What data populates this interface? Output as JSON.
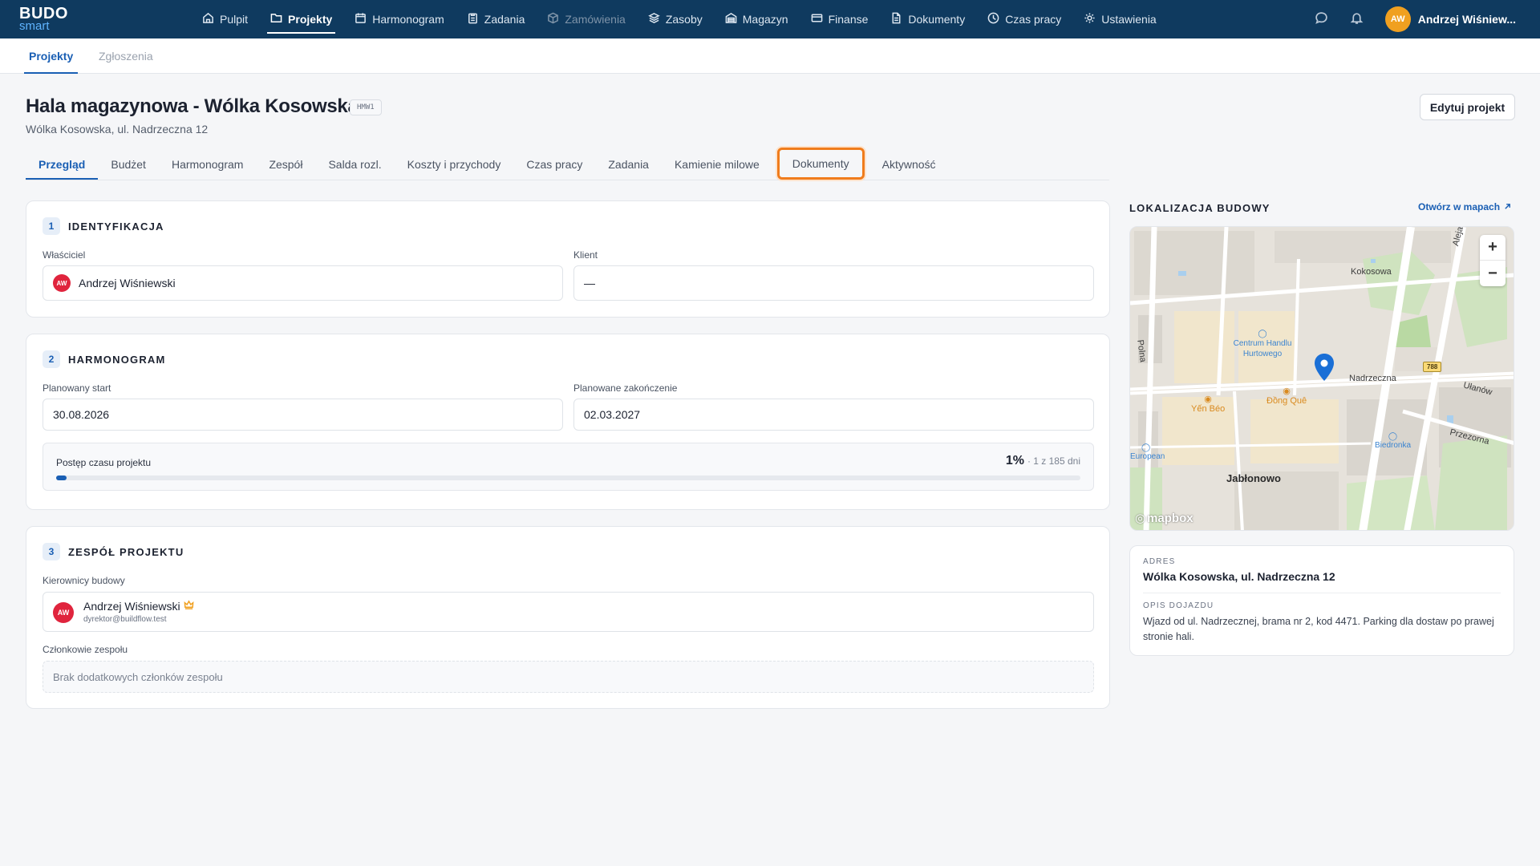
{
  "app": {
    "logo_top": "BUDO",
    "logo_bottom": "smart"
  },
  "topnav": {
    "items": [
      {
        "label": "Pulpit",
        "icon": "home-icon"
      },
      {
        "label": "Projekty",
        "icon": "folder-icon",
        "active": true
      },
      {
        "label": "Harmonogram",
        "icon": "calendar-icon"
      },
      {
        "label": "Zadania",
        "icon": "clipboard-icon"
      },
      {
        "label": "Zamówienia",
        "icon": "box-icon",
        "disabled": true
      },
      {
        "label": "Zasoby",
        "icon": "layers-icon"
      },
      {
        "label": "Magazyn",
        "icon": "warehouse-icon"
      },
      {
        "label": "Finanse",
        "icon": "card-icon"
      },
      {
        "label": "Dokumenty",
        "icon": "document-icon"
      },
      {
        "label": "Czas pracy",
        "icon": "clock-icon"
      },
      {
        "label": "Ustawienia",
        "icon": "gear-icon"
      }
    ],
    "user_initials": "AW",
    "user_name": "Andrzej Wiśniew..."
  },
  "subnav": {
    "items": [
      "Projekty",
      "Zgłoszenia"
    ]
  },
  "project": {
    "title": "Hala magazynowa - Wólka Kosowska",
    "code": "HMW1",
    "address": "Wólka Kosowska, ul. Nadrzeczna 12",
    "edit_label": "Edytuj projekt"
  },
  "tabs": [
    "Przegląd",
    "Budżet",
    "Harmonogram",
    "Zespół",
    "Salda rozl.",
    "Koszty i przychody",
    "Czas pracy",
    "Zadania",
    "Kamienie milowe",
    "Dokumenty",
    "Aktywność"
  ],
  "identification": {
    "num": "1",
    "title": "IDENTYFIKACJA",
    "owner_label": "Właściciel",
    "owner_initials": "AW",
    "owner_name": "Andrzej Wiśniewski",
    "client_label": "Klient",
    "client_value": "—"
  },
  "schedule": {
    "num": "2",
    "title": "HARMONOGRAM",
    "start_label": "Planowany start",
    "start_value": "30.08.2026",
    "end_label": "Planowane zakończenie",
    "end_value": "02.03.2027",
    "progress_label": "Postęp czasu projektu",
    "progress_pct": "1%",
    "progress_detail": "· 1 z 185 dni",
    "progress_fraction": 0.01
  },
  "team": {
    "num": "3",
    "title": "ZESPÓŁ PROJEKTU",
    "managers_label": "Kierownicy budowy",
    "manager_initials": "AW",
    "manager_name": "Andrzej Wiśniewski",
    "manager_email": "dyrektor@buildflow.test",
    "members_label": "Członkowie zespołu",
    "members_empty": "Brak dodatkowych członków zespołu"
  },
  "location": {
    "title": "LOKALIZACJA BUDOWY",
    "open_maps": "Otwórz w mapach",
    "zoom_in": "+",
    "zoom_out": "−",
    "map_labels": {
      "kokosowa": "Kokosowa",
      "aleja": "Aleja Kra",
      "polna": "Polna",
      "centrum": "Centrum Handlu Hurtowego",
      "nadrzeczna": "Nadrzeczna",
      "road_num": "788",
      "ulanow": "Ułanów",
      "yen_beo": "Yến Béo",
      "dong_que": "Đồng Quê",
      "przezorna": "Przezorna",
      "european": "European",
      "biedronka": "Biedronka",
      "jablonowo": "Jabłonowo",
      "mapbox": "mapbox"
    },
    "address_label": "ADRES",
    "address_value": "Wólka Kosowska, ul. Nadrzeczna 12",
    "directions_label": "OPIS DOJAZDU",
    "directions_value": "Wjazd od ul. Nadrzecznej, brama nr 2, kod 4471. Parking dla dostaw po prawej stronie hali."
  },
  "colors": {
    "nav_bg": "#0f3a5f",
    "accent": "#1a5fb4",
    "focus_ring": "#f07c1c",
    "avatar_red": "#e0243d",
    "avatar_orange": "#f0a020"
  }
}
